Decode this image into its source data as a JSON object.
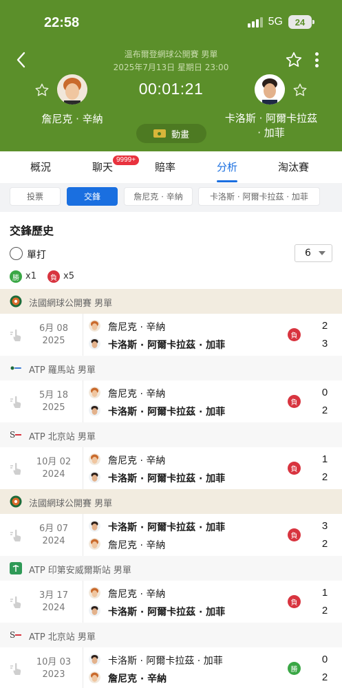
{
  "status_bar": {
    "time": "22:58",
    "network": "5G",
    "battery": "24"
  },
  "match": {
    "title": "溫布爾登網球公開賽 男單",
    "date": "2025年7月13日 星期日 23:00",
    "timer": "00:01:21",
    "player_left": "詹尼克 · 辛納",
    "player_right": "卡洛斯 · 阿爾卡拉茲 · 加菲",
    "animation_label": "動畫"
  },
  "tabs": [
    {
      "label": "概況"
    },
    {
      "label": "聊天",
      "badge": "9999+"
    },
    {
      "label": "賠率"
    },
    {
      "label": "分析",
      "active": true
    },
    {
      "label": "淘汰賽"
    }
  ],
  "subtabs": [
    {
      "label": "投票"
    },
    {
      "label": "交鋒",
      "active": true
    },
    {
      "label": "詹尼克 · 辛納"
    },
    {
      "label": "卡洛斯 · 阿爾卡拉茲 · 加菲"
    }
  ],
  "h2h": {
    "title": "交鋒歷史",
    "filter_label": "單打",
    "select_value": "6",
    "win_label": "勝",
    "win_count": "x1",
    "lose_label": "負",
    "lose_count": "x5"
  },
  "matches": [
    {
      "tournament": "法國網球公開賽 男單",
      "date": "6月 08",
      "year": "2025",
      "top": "詹尼克 · 辛納",
      "bottom": "卡洛斯 · 阿爾卡拉茲 · 加菲",
      "top_bold": false,
      "result": "負",
      "score_top": "2",
      "score_bottom": "3"
    },
    {
      "tournament": "ATP 羅馬站 男單",
      "date": "5月 18",
      "year": "2025",
      "top": "詹尼克 · 辛納",
      "bottom": "卡洛斯 · 阿爾卡拉茲 · 加菲",
      "top_bold": false,
      "result": "負",
      "score_top": "0",
      "score_bottom": "2"
    },
    {
      "tournament": "ATP 北京站 男單",
      "date": "10月 02",
      "year": "2024",
      "top": "詹尼克 · 辛納",
      "bottom": "卡洛斯 · 阿爾卡拉茲 · 加菲",
      "top_bold": false,
      "result": "負",
      "score_top": "1",
      "score_bottom": "2"
    },
    {
      "tournament": "法國網球公開賽 男單",
      "date": "6月 07",
      "year": "2024",
      "top": "卡洛斯 · 阿爾卡拉茲 · 加菲",
      "bottom": "詹尼克 · 辛納",
      "top_bold": true,
      "result": "負",
      "score_top": "3",
      "score_bottom": "2"
    },
    {
      "tournament": "ATP 印第安威爾斯站 男單",
      "date": "3月 17",
      "year": "2024",
      "top": "詹尼克 · 辛納",
      "bottom": "卡洛斯 · 阿爾卡拉茲 · 加菲",
      "top_bold": false,
      "result": "負",
      "score_top": "1",
      "score_bottom": "2"
    },
    {
      "tournament": "ATP 北京站 男單",
      "date": "10月 03",
      "year": "2023",
      "top": "卡洛斯 · 阿爾卡拉茲 · 加菲",
      "bottom": "詹尼克 · 辛納",
      "top_bold": false,
      "result": "勝",
      "score_top": "0",
      "score_bottom": "2"
    }
  ],
  "colors": {
    "header_green": "#5b8f2a",
    "accent_blue": "#1a6fe0",
    "win_green": "#3aa745",
    "lose_red": "#d8343f"
  },
  "icons": [
    "back-icon",
    "star-icon",
    "more-icon",
    "swipe-hand-icon",
    "roland-garros-logo",
    "rome-logo",
    "beijing-logo",
    "indian-wells-logo"
  ]
}
